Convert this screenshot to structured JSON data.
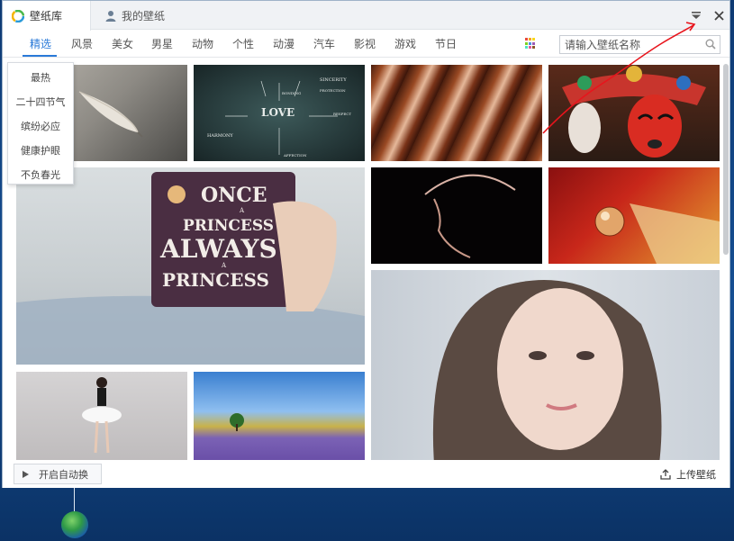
{
  "window": {
    "tabs": [
      {
        "label": "壁纸库",
        "icon": "app-logo-icon"
      },
      {
        "label": "我的壁纸",
        "icon": "user-icon"
      }
    ],
    "controls": {
      "menu_icon": "dropdown-menu-icon",
      "close_icon": "close-icon"
    }
  },
  "nav": {
    "items": [
      "精选",
      "风景",
      "美女",
      "男星",
      "动物",
      "个性",
      "动漫",
      "汽车",
      "影视",
      "游戏",
      "节日"
    ],
    "active_index": 0
  },
  "search": {
    "placeholder": "请输入壁纸名称",
    "icon": "search-icon"
  },
  "dropdown": {
    "items": [
      "最热",
      "二十四节气",
      "缤纷必应",
      "健康护眼",
      "不负春光"
    ]
  },
  "wallpapers": [
    {
      "name": "feather"
    },
    {
      "name": "love-chalkboard",
      "words": [
        "SINCERITY",
        "BONDING",
        "PROTECTION",
        "LOVE",
        "RESPECT",
        "HARMONY",
        "AFFECTION"
      ]
    },
    {
      "name": "wooden-stripes"
    },
    {
      "name": "opera-mask"
    },
    {
      "name": "mug-once-princess",
      "lines": [
        "ONCE",
        "A",
        "PRINCESS",
        "ALWAYS",
        "A",
        "PRINCESS"
      ]
    },
    {
      "name": "silhouette-hat"
    },
    {
      "name": "marble-leaf"
    },
    {
      "name": "portrait-girl"
    },
    {
      "name": "ballerina"
    },
    {
      "name": "lavender-field"
    }
  ],
  "footer": {
    "autoplay_label": "开启自动换",
    "upload_label": "上传壁纸"
  },
  "colors": {
    "accent": "#2a7ad8",
    "annotation": "#e8141c"
  }
}
